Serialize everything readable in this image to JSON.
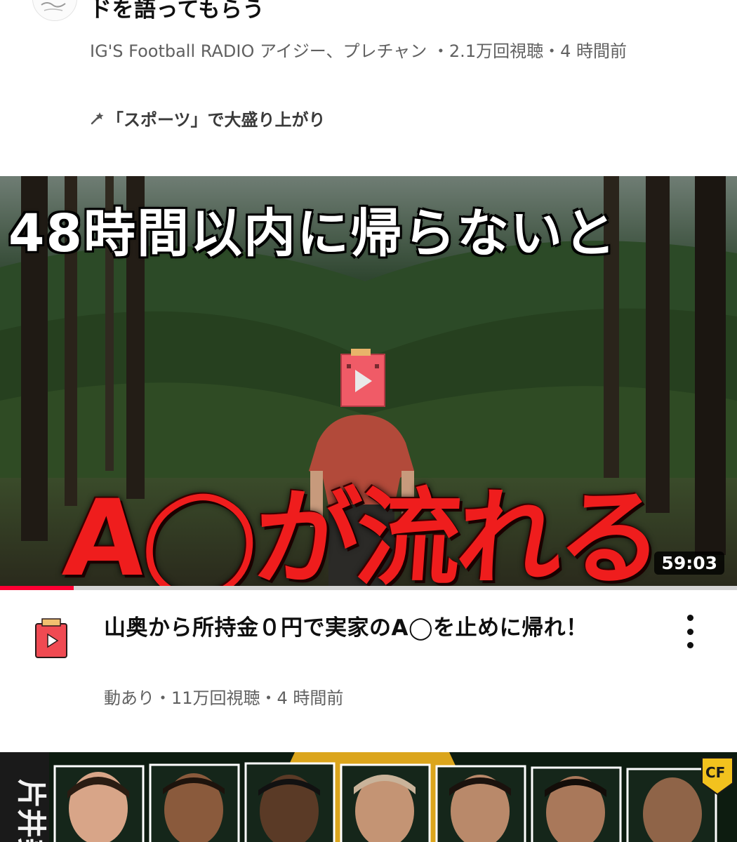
{
  "top_video": {
    "title": "ドを語ってもらう",
    "channel": "IG'S Football RADIO アイジー、プレチャン",
    "views": "2.1万回視聴",
    "age": "4 時間前",
    "meta_line": "IG'S Football RADIO アイジー、プレチャン ・2.1万回視聴・4 時間前",
    "trend_label": "「スポーツ」で大盛り上がり",
    "avatar_icon": "channel-avatar-icon"
  },
  "main_video": {
    "thumbnail_text_top": "48時間以内に帰らないと",
    "thumbnail_text_bottom": "A◯が流れる",
    "duration": "59:03",
    "progress_fraction": 0.1,
    "title": "山奥から所持金０円で実家のA◯を止めに帰れ！",
    "meta_line": "動あり・11万回視聴・4 時間前",
    "channel": "動あり",
    "views": "11万回視聴",
    "age": "4 時間前",
    "more_icon": "more-vert-icon"
  },
  "next_video": {
    "badge_text": "CF",
    "side_text": "片井美"
  },
  "colors": {
    "progress": "#ff0033",
    "thumb_red_text": "#ef1d1d",
    "meta_gray": "#606060"
  }
}
